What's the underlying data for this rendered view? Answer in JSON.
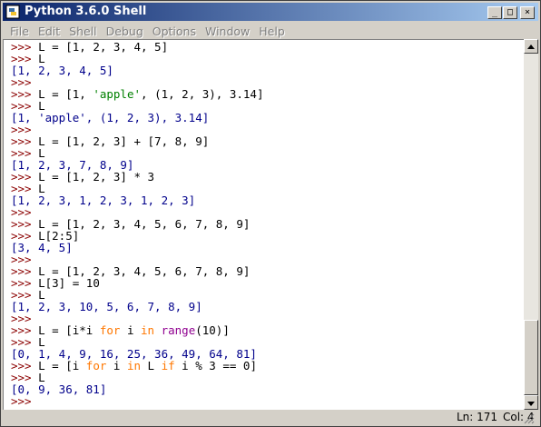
{
  "window": {
    "title": "Python 3.6.0 Shell",
    "buttons": {
      "minimize": "_",
      "maximize": "□",
      "close": "×"
    }
  },
  "menu": [
    "File",
    "Edit",
    "Shell",
    "Debug",
    "Options",
    "Window",
    "Help"
  ],
  "colors": {
    "prompt": "#8b0000",
    "code": "#000000",
    "output": "#00008b",
    "string": "#008000",
    "keyword": "#ff7700",
    "builtin": "#900090",
    "title_bar_start": "#0a246a",
    "title_bar_end": "#a6caf0"
  },
  "shell_lines": [
    {
      "kind": "input",
      "prompt": ">>> ",
      "segments": [
        {
          "t": "L = [1, 2, 3, 4, 5]",
          "k": "code"
        }
      ]
    },
    {
      "kind": "input",
      "prompt": ">>> ",
      "segments": [
        {
          "t": "L",
          "k": "code"
        }
      ]
    },
    {
      "kind": "output",
      "segments": [
        {
          "t": "[1, 2, 3, 4, 5]",
          "k": "out"
        }
      ]
    },
    {
      "kind": "input",
      "prompt": ">>> ",
      "segments": []
    },
    {
      "kind": "input",
      "prompt": ">>> ",
      "segments": [
        {
          "t": "L = [1, ",
          "k": "code"
        },
        {
          "t": "'apple'",
          "k": "string"
        },
        {
          "t": ", (1, 2, 3), 3.14]",
          "k": "code"
        }
      ]
    },
    {
      "kind": "input",
      "prompt": ">>> ",
      "segments": [
        {
          "t": "L",
          "k": "code"
        }
      ]
    },
    {
      "kind": "output",
      "segments": [
        {
          "t": "[1, 'apple', (1, 2, 3), 3.14]",
          "k": "out"
        }
      ]
    },
    {
      "kind": "input",
      "prompt": ">>> ",
      "segments": []
    },
    {
      "kind": "input",
      "prompt": ">>> ",
      "segments": [
        {
          "t": "L = [1, 2, 3] + [7, 8, 9]",
          "k": "code"
        }
      ]
    },
    {
      "kind": "input",
      "prompt": ">>> ",
      "segments": [
        {
          "t": "L",
          "k": "code"
        }
      ]
    },
    {
      "kind": "output",
      "segments": [
        {
          "t": "[1, 2, 3, 7, 8, 9]",
          "k": "out"
        }
      ]
    },
    {
      "kind": "input",
      "prompt": ">>> ",
      "segments": [
        {
          "t": "L = [1, 2, 3] * 3",
          "k": "code"
        }
      ]
    },
    {
      "kind": "input",
      "prompt": ">>> ",
      "segments": [
        {
          "t": "L",
          "k": "code"
        }
      ]
    },
    {
      "kind": "output",
      "segments": [
        {
          "t": "[1, 2, 3, 1, 2, 3, 1, 2, 3]",
          "k": "out"
        }
      ]
    },
    {
      "kind": "input",
      "prompt": ">>> ",
      "segments": []
    },
    {
      "kind": "input",
      "prompt": ">>> ",
      "segments": [
        {
          "t": "L = [1, 2, 3, 4, 5, 6, 7, 8, 9]",
          "k": "code"
        }
      ]
    },
    {
      "kind": "input",
      "prompt": ">>> ",
      "segments": [
        {
          "t": "L[2:5]",
          "k": "code"
        }
      ]
    },
    {
      "kind": "output",
      "segments": [
        {
          "t": "[3, 4, 5]",
          "k": "out"
        }
      ]
    },
    {
      "kind": "input",
      "prompt": ">>> ",
      "segments": []
    },
    {
      "kind": "input",
      "prompt": ">>> ",
      "segments": [
        {
          "t": "L = [1, 2, 3, 4, 5, 6, 7, 8, 9]",
          "k": "code"
        }
      ]
    },
    {
      "kind": "input",
      "prompt": ">>> ",
      "segments": [
        {
          "t": "L[3] = 10",
          "k": "code"
        }
      ]
    },
    {
      "kind": "input",
      "prompt": ">>> ",
      "segments": [
        {
          "t": "L",
          "k": "code"
        }
      ]
    },
    {
      "kind": "output",
      "segments": [
        {
          "t": "[1, 2, 3, 10, 5, 6, 7, 8, 9]",
          "k": "out"
        }
      ]
    },
    {
      "kind": "input",
      "prompt": ">>> ",
      "segments": []
    },
    {
      "kind": "input",
      "prompt": ">>> ",
      "segments": [
        {
          "t": "L = [i*i ",
          "k": "code"
        },
        {
          "t": "for",
          "k": "keyword"
        },
        {
          "t": " i ",
          "k": "code"
        },
        {
          "t": "in",
          "k": "keyword"
        },
        {
          "t": " ",
          "k": "code"
        },
        {
          "t": "range",
          "k": "builtin"
        },
        {
          "t": "(10)]",
          "k": "code"
        }
      ]
    },
    {
      "kind": "input",
      "prompt": ">>> ",
      "segments": [
        {
          "t": "L",
          "k": "code"
        }
      ]
    },
    {
      "kind": "output",
      "segments": [
        {
          "t": "[0, 1, 4, 9, 16, 25, 36, 49, 64, 81]",
          "k": "out"
        }
      ]
    },
    {
      "kind": "input",
      "prompt": ">>> ",
      "segments": [
        {
          "t": "L = [i ",
          "k": "code"
        },
        {
          "t": "for",
          "k": "keyword"
        },
        {
          "t": " i ",
          "k": "code"
        },
        {
          "t": "in",
          "k": "keyword"
        },
        {
          "t": " L ",
          "k": "code"
        },
        {
          "t": "if",
          "k": "keyword"
        },
        {
          "t": " i % 3 == 0]",
          "k": "code"
        }
      ]
    },
    {
      "kind": "input",
      "prompt": ">>> ",
      "segments": [
        {
          "t": "L",
          "k": "code"
        }
      ]
    },
    {
      "kind": "output",
      "segments": [
        {
          "t": "[0, 9, 36, 81]",
          "k": "out"
        }
      ]
    },
    {
      "kind": "input",
      "prompt": ">>> ",
      "segments": []
    }
  ],
  "status": {
    "line": "Ln: 171",
    "col": "Col: 4"
  }
}
